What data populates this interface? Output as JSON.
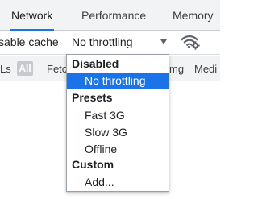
{
  "tabs": [
    {
      "label": "Network",
      "active": true
    },
    {
      "label": "Performance",
      "active": false
    },
    {
      "label": "Memory",
      "active": false
    }
  ],
  "toolbar": {
    "disable_cache_label": "sable cache",
    "throttling_value": "No throttling",
    "network_conditions_icon": "wifi-settings-icon"
  },
  "filterbar": {
    "left_partial": "Ls",
    "all_label": "All",
    "fetch_partial": "Fetc",
    "img_partial": "mg",
    "media_partial": "Medi"
  },
  "dropdown": {
    "groups": [
      {
        "header": "Disabled",
        "items": [
          {
            "label": "No throttling",
            "selected": true
          }
        ]
      },
      {
        "header": "Presets",
        "items": [
          {
            "label": "Fast 3G",
            "selected": false
          },
          {
            "label": "Slow 3G",
            "selected": false
          },
          {
            "label": "Offline",
            "selected": false
          }
        ]
      },
      {
        "header": "Custom",
        "items": [
          {
            "label": "Add...",
            "selected": false
          }
        ]
      }
    ]
  },
  "colors": {
    "accent": "#1a73e8",
    "tab_bar_bg": "#f1f3f4",
    "chip_bg": "#c7c9cc"
  }
}
